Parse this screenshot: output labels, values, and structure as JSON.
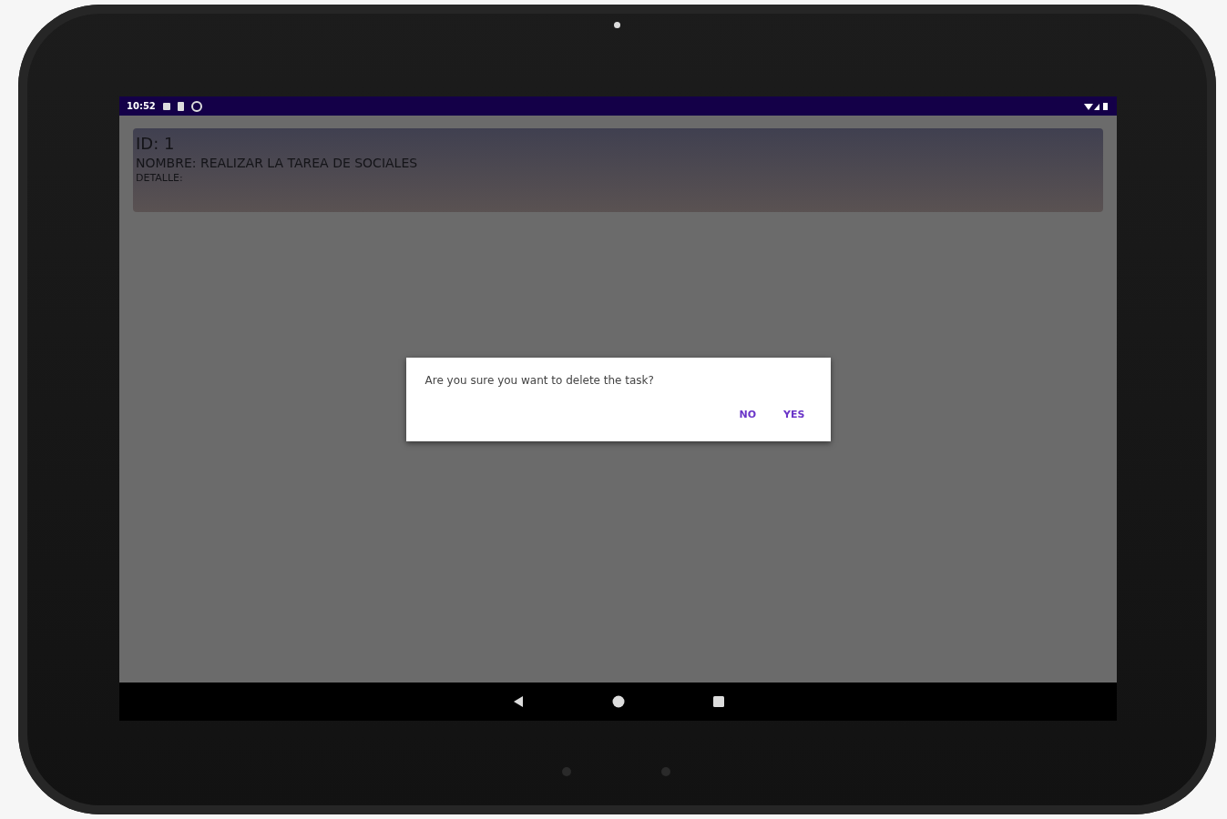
{
  "status_bar": {
    "time": "10:52"
  },
  "task_card": {
    "id": "ID: 1",
    "name": "NOMBRE: REALIZAR LA TAREA DE SOCIALES",
    "detail": "DETALLE:"
  },
  "dialog": {
    "message": "Are you sure you want to delete the task?",
    "buttons": [
      "NO",
      "YES"
    ]
  }
}
